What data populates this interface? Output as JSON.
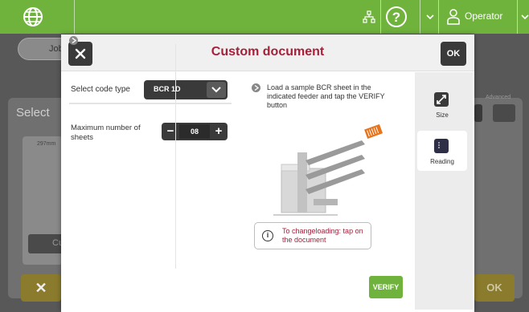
{
  "topbar": {
    "user_label": "Operator",
    "accent": "#6fb33d",
    "icons": [
      "globe-icon",
      "network-icon",
      "help-icon",
      "chevron-down-icon",
      "user-icon"
    ]
  },
  "background": {
    "back_label": "Job",
    "panel_title": "Select",
    "card_label": "297mm",
    "card_button_label": "Cu",
    "advanced_label": "Advanced",
    "ok_label": "OK",
    "cancel_symbol": "✕"
  },
  "modal": {
    "title": "Custom document",
    "title_color": "#a6203a",
    "ok_label": "OK",
    "close_icon": "close-icon",
    "code_type": {
      "label": "Select code type",
      "value": "BCR 1D"
    },
    "max_sheets": {
      "label": "Maximum number of sheets",
      "value": "08",
      "minus": "−",
      "plus": "+"
    },
    "instruction": "Load a sample BCR sheet in the indicated feeder and tap the VERIFY button",
    "loading_note": "To changeloading: tap on the document",
    "verify_label": "VERIFY",
    "tabs": [
      {
        "label": "Size",
        "icon": "resize-icon",
        "active": false
      },
      {
        "label": "Reading",
        "icon": "document-icon",
        "active": true
      }
    ]
  }
}
